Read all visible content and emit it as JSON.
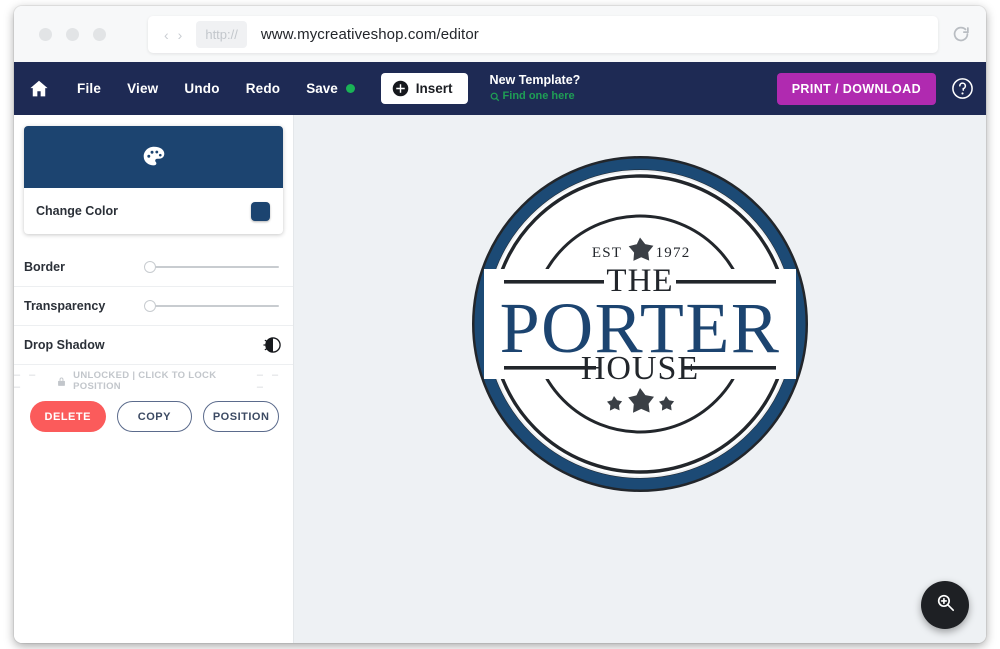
{
  "browser": {
    "url": "www.mycreativeshop.com/editor",
    "protocol_chip": "http://",
    "back_label": "‹",
    "forward_label": "›"
  },
  "toolbar": {
    "home_icon": "home-icon",
    "menu": [
      {
        "label": "File",
        "name": "menu-file"
      },
      {
        "label": "View",
        "name": "menu-view"
      },
      {
        "label": "Undo",
        "name": "menu-undo"
      },
      {
        "label": "Redo",
        "name": "menu-redo"
      }
    ],
    "save_label": "Save",
    "insert_label": "Insert",
    "new_template_title": "New Template?",
    "new_template_link": "Find one here",
    "print_label": "PRINT / DOWNLOAD",
    "help_icon": "question-mark-icon",
    "accent_navy": "#1e2a54",
    "accent_magenta": "#b02ab0",
    "save_dot_color": "#19b356",
    "link_green": "#1f9e55"
  },
  "sidebar": {
    "color_card": {
      "icon": "palette-icon",
      "label": "Change Color",
      "swatch_color": "#1c4470",
      "header_color": "#1c4470"
    },
    "properties": [
      {
        "label": "Border",
        "name": "border-slider",
        "value": 0,
        "control": "slider"
      },
      {
        "label": "Transparency",
        "name": "transparency-slider",
        "value": 0,
        "control": "slider"
      },
      {
        "label": "Drop Shadow",
        "name": "drop-shadow-toggle",
        "control": "icon-toggle",
        "icon": "contrast-icon"
      }
    ],
    "lock": {
      "dashes": "– – –",
      "icon": "lock-icon",
      "text": "UNLOCKED | CLICK TO LOCK POSITION"
    },
    "actions": [
      {
        "label": "DELETE",
        "name": "delete-button",
        "style": "danger"
      },
      {
        "label": "COPY",
        "name": "copy-button",
        "style": "outline"
      },
      {
        "label": "POSITION",
        "name": "position-button",
        "style": "outline"
      }
    ]
  },
  "canvas": {
    "background": "#eef1f4",
    "logo": {
      "est_label": "EST",
      "year": "1972",
      "line1": "THE",
      "line2": "PORTER",
      "line3": "HOUSE",
      "ring_color": "#1c4a75",
      "text_color": "#1c4470",
      "dark_color": "#22262b",
      "star_count_bottom": 3
    },
    "zoom_button_icon": "magnifier-plus-icon"
  }
}
